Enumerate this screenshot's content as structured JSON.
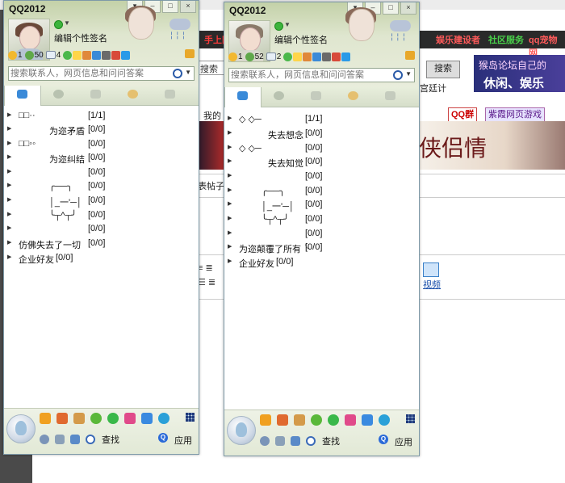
{
  "background": {
    "nav_items": [
      {
        "label": "手上网",
        "color": "#ff3a3a"
      },
      {
        "label": "娱乐建设者",
        "color": "#ff5a5a"
      },
      {
        "label": "社区服务",
        "color": "#49d04a"
      },
      {
        "label": "qq宠物网",
        "color": "#ff5a5a"
      }
    ],
    "search_prefix": "搜索",
    "search_button": "搜索",
    "gong_text": "宫廷计",
    "banner_line1": "猴岛论坛自己的",
    "banner_line2": "休闲、娱乐",
    "wo_text": "我的",
    "qq_group_label": "QQ群",
    "game_label": "紫霞网页游戏",
    "banner2_text": "侠侣情",
    "thread_text": "表帖子",
    "video_label": "视频"
  },
  "windows": [
    {
      "title": "QQ2012",
      "signature": "编辑个性签名",
      "level_count": "1",
      "message_count": "50",
      "mail_count": "4",
      "search_placeholder": "搜索联系人，网页信息和问问答案",
      "groups": [
        {
          "name": "□□··",
          "count": "[1/1]"
        },
        {
          "name": "为迩矛盾",
          "count": "[0/0]"
        },
        {
          "name": "□□◦◦",
          "count": "[0/0]"
        },
        {
          "name": "为迩纠结",
          "count": "[0/0]"
        },
        {
          "name": "",
          "count": "[0/0]"
        },
        {
          "name": "╭──╮",
          "count": "[0/0]"
        },
        {
          "name": "│_一'─│",
          "count": "[0/0]"
        },
        {
          "name": "╰┬^┬╯",
          "count": "[0/0]"
        },
        {
          "name": "",
          "count": "[0/0]"
        },
        {
          "name": "仿佛失去了一切",
          "count": "[0/0]"
        },
        {
          "name": "企业好友",
          "count": "[0/0]"
        }
      ],
      "find_label": "查找",
      "apps_label": "应用"
    },
    {
      "title": "QQ2012",
      "signature": "编辑个性签名",
      "level_count": "1",
      "message_count": "52",
      "mail_count": "2",
      "search_placeholder": "搜索联系人，网页信息和问问答案",
      "groups": [
        {
          "name": "◇ ◇─",
          "count": "[1/1]"
        },
        {
          "name": "失去想念",
          "count": "[0/0]"
        },
        {
          "name": "◇ ◇─",
          "count": "[0/0]"
        },
        {
          "name": "失去知觉",
          "count": "[0/0]"
        },
        {
          "name": "",
          "count": "[0/0]"
        },
        {
          "name": "╭──╮",
          "count": "[0/0]"
        },
        {
          "name": "│_一'─│",
          "count": "[0/0]"
        },
        {
          "name": "╰┬^┬╯",
          "count": "[0/0]"
        },
        {
          "name": "",
          "count": "[0/0]"
        },
        {
          "name": "为迩颠覆了所有╰",
          "count": "[0/0]"
        },
        {
          "name": "企业好友",
          "count": "[0/0]"
        }
      ],
      "find_label": "查找",
      "apps_label": "应用"
    }
  ]
}
